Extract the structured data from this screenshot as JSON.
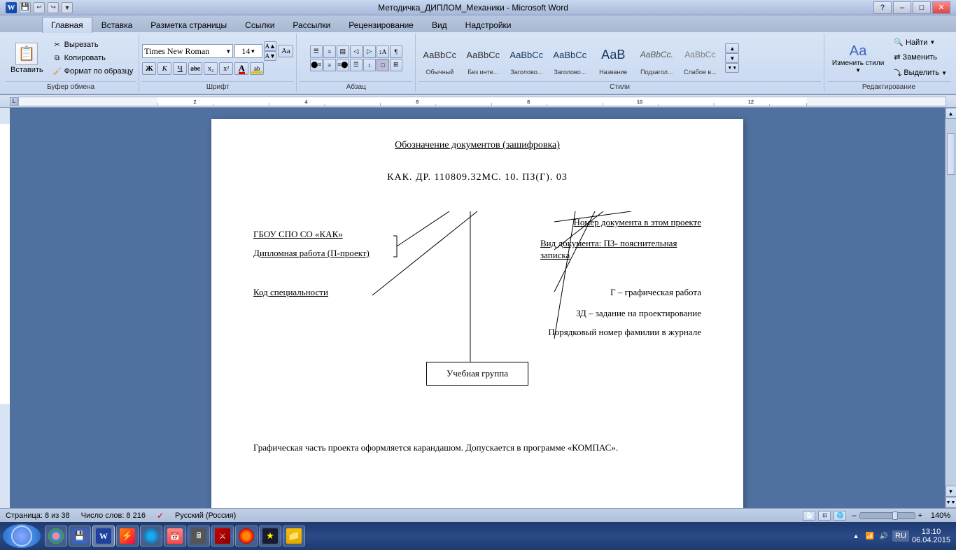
{
  "window": {
    "title": "Методичка_ДИПЛОМ_Механики - Microsoft Word",
    "min_btn": "–",
    "max_btn": "□",
    "close_btn": "✕"
  },
  "ribbon": {
    "tabs": [
      "Главная",
      "Вставка",
      "Разметка страницы",
      "Ссылки",
      "Рассылки",
      "Рецензирование",
      "Вид",
      "Надстройки"
    ],
    "active_tab": "Главная",
    "groups": {
      "clipboard": {
        "label": "Буфер обмена",
        "paste": "Вставить",
        "cut": "Вырезать",
        "copy": "Копировать",
        "format_painter": "Формат по образцу"
      },
      "font": {
        "label": "Шрифт",
        "name": "Times New Roman",
        "size": "14",
        "bold": "Ж",
        "italic": "К",
        "underline": "Ч",
        "strikethrough": "abc",
        "subscript": "x₂",
        "superscript": "x²"
      },
      "paragraph": {
        "label": "Абзац"
      },
      "styles": {
        "label": "Стили",
        "items": [
          {
            "name": "Обычный",
            "label": "AaBbCс"
          },
          {
            "name": "Без инте...",
            "label": "AaBbCс"
          },
          {
            "name": "Заголово...",
            "label": "AaBbCс"
          },
          {
            "name": "Заголово...",
            "label": "AaBbCс"
          },
          {
            "name": "Название",
            "label": "АаВ"
          },
          {
            "name": "Подзагол...",
            "label": "AaBbCс."
          },
          {
            "name": "Слабое в...",
            "label": "AaBbCс"
          }
        ]
      },
      "editing": {
        "label": "Редактирование",
        "find": "Найти",
        "replace": "Заменить",
        "select": "Выделить",
        "change_styles": "Изменить стили"
      }
    }
  },
  "document": {
    "title_text": "Обозначение документов (зашифровка)",
    "code_text": "КАК. ДР. 110809.32МС. 10. ПЗ(Г). 03",
    "labels": {
      "left_top": "ГБОУ СПО СО «КАК»",
      "left_mid": "Дипломная работа (П-проект)",
      "left_bottom": "Код специальности",
      "right_1": "Номер документа в этом проекте",
      "right_2": "Вид документа: ПЗ- пояснительная записка",
      "right_3": "Г – графическая работа",
      "right_4": "ЗД – задание на проектирование",
      "right_5": "Порядковый номер фамилии в журнале"
    },
    "group_box": "Учебная группа",
    "footer_text": "Графическая часть проекта оформляется карандашом. Допускается в программе «КОМПАС»."
  },
  "status_bar": {
    "page": "Страница: 8 из 38",
    "words": "Число слов: 8 216",
    "language": "Русский (Россия)",
    "zoom": "140%"
  },
  "taskbar": {
    "lang": "RU",
    "time": "13:10",
    "date": "06.04.2015"
  }
}
